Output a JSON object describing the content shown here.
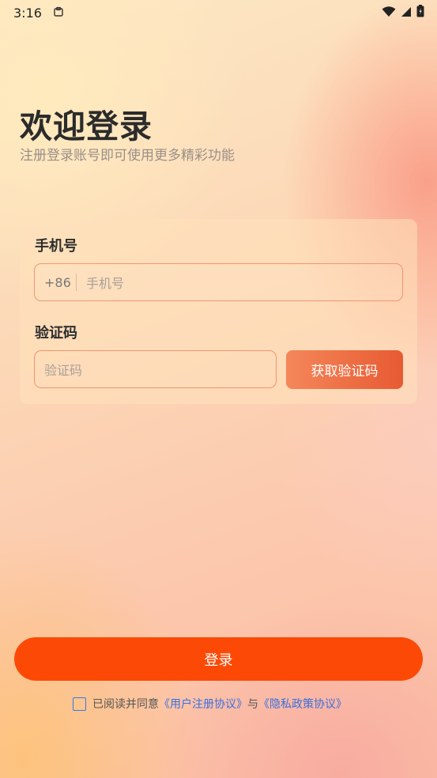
{
  "status_bar": {
    "time": "3:16",
    "icons": [
      "clipboard-icon",
      "wifi-icon",
      "signal-icon",
      "battery-icon"
    ]
  },
  "header": {
    "title": "欢迎登录",
    "subtitle": "注册登录账号即可使用更多精彩功能"
  },
  "form": {
    "phone_label": "手机号",
    "phone_prefix": "+86",
    "phone_placeholder": "手机号",
    "code_label": "验证码",
    "code_placeholder": "验证码",
    "get_code_label": "获取验证码"
  },
  "login_label": "登录",
  "agreement": {
    "text": "已阅读并同意",
    "user_agreement": "《用户注册协议》",
    "conjunction": "与",
    "privacy_policy": "《隐私政策协议》"
  },
  "colors": {
    "accent": "#fc4a06",
    "input_border": "#f29570",
    "link": "#3b6fe0"
  }
}
